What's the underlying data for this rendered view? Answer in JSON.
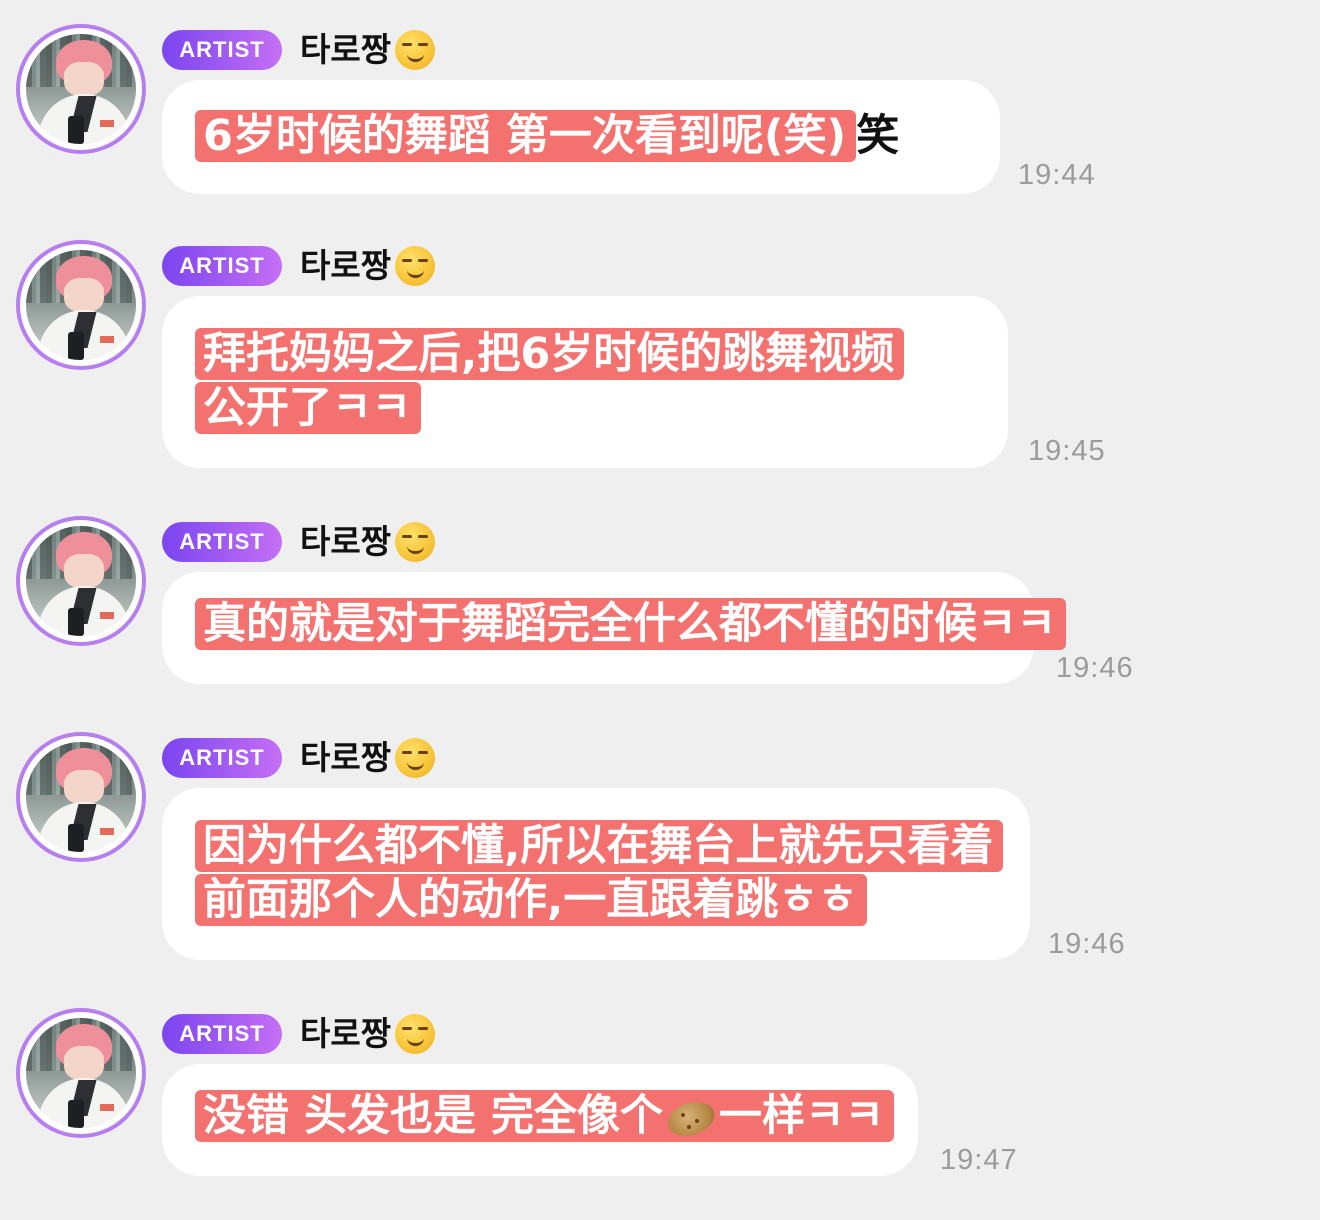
{
  "messages": [
    {
      "badge": "ARTIST",
      "sender": "타로짱",
      "lines": [
        "6岁时候的舞蹈 第一次看到呢(笑)"
      ],
      "tail": "笑",
      "time": "19:44"
    },
    {
      "badge": "ARTIST",
      "sender": "타로짱",
      "lines": [
        "拜托妈妈之后,把6岁时候的跳舞视频",
        "公开了ㅋㅋ"
      ],
      "time": "19:45"
    },
    {
      "badge": "ARTIST",
      "sender": "타로짱",
      "lines": [
        "真的就是对于舞蹈完全什么都不懂的时候ㅋㅋ"
      ],
      "time": "19:46"
    },
    {
      "badge": "ARTIST",
      "sender": "타로짱",
      "lines": [
        "因为什么都不懂,所以在舞台上就先只看着",
        "前面那个人的动作,一直跟着跳ㅎㅎ"
      ],
      "time": "19:46"
    },
    {
      "badge": "ARTIST",
      "sender": "타로짱",
      "line_before_emoji": "没错 头发也是 完全像个",
      "line_after_emoji": "一样ㅋㅋ",
      "emoji_name": "potato-icon",
      "time": "19:47"
    }
  ],
  "icons": {
    "sender_emoji": "smirking-face-icon",
    "avatar": "avatar-pink-hair-portrait"
  },
  "colors": {
    "background": "#efefef",
    "bubble": "#ffffff",
    "highlight": "#f37270",
    "badge_start": "#7b45ef",
    "badge_end": "#c56ff5",
    "avatar_ring": "#b77ef0",
    "time": "#9b9b9b"
  }
}
